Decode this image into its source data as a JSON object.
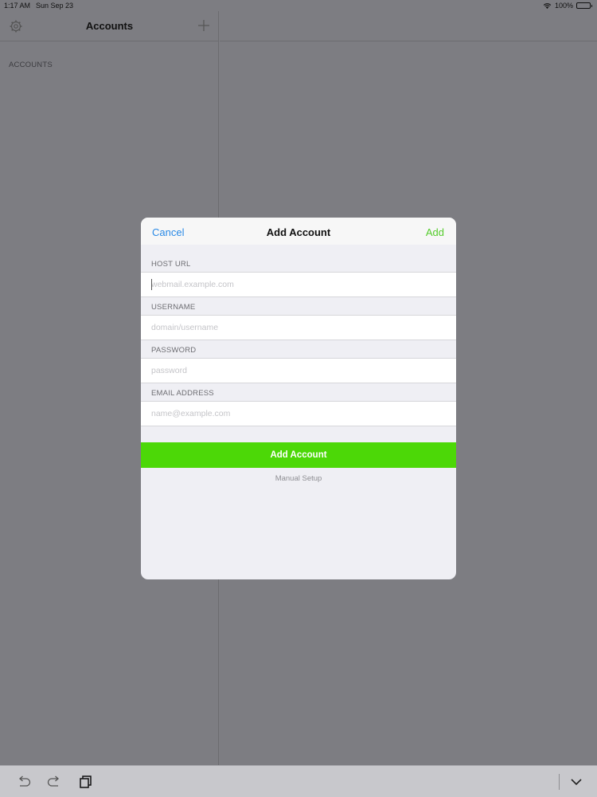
{
  "status_bar": {
    "time": "1:17 AM",
    "date": "Sun Sep 23",
    "battery": "100%"
  },
  "sidebar": {
    "title": "Accounts",
    "section_label": "ACCOUNTS",
    "settings_icon": "gear-icon",
    "add_icon": "plus-icon"
  },
  "modal": {
    "nav": {
      "cancel_label": "Cancel",
      "title": "Add Account",
      "add_label": "Add"
    },
    "fields": {
      "host_url": {
        "label": "HOST URL",
        "value": "",
        "placeholder": "webmail.example.com"
      },
      "username": {
        "label": "USERNAME",
        "value": "",
        "placeholder": "domain/username"
      },
      "password": {
        "label": "PASSWORD",
        "value": "",
        "placeholder": "password"
      },
      "email": {
        "label": "EMAIL ADDRESS",
        "value": "",
        "placeholder": "name@example.com"
      }
    },
    "add_account_button": "Add Account",
    "manual_setup_link": "Manual Setup"
  },
  "toolbar": {
    "icons": [
      "undo-icon",
      "redo-icon",
      "copy-icon",
      "chevron-down-icon"
    ]
  },
  "colors": {
    "accent_blue": "#2a8ae6",
    "accent_green": "#4cd807",
    "backdrop": "#7d7d82"
  }
}
